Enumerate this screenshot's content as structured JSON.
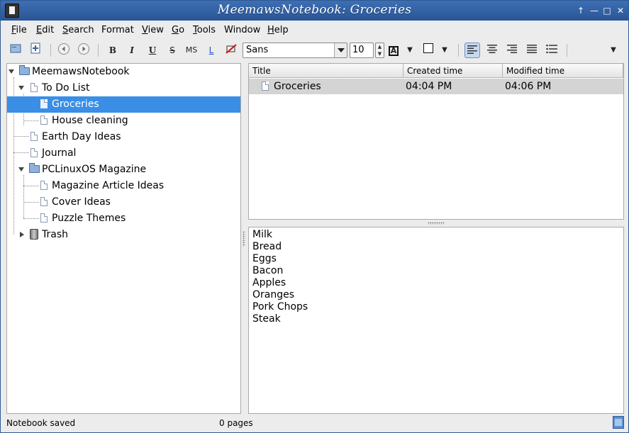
{
  "window": {
    "title": "MeemawsNotebook: Groceries"
  },
  "menubar": [
    {
      "label": "File",
      "accel": "F",
      "rest": "ile"
    },
    {
      "label": "Edit",
      "accel": "E",
      "rest": "dit"
    },
    {
      "label": "Search",
      "accel": "S",
      "rest": "earch"
    },
    {
      "label": "Format",
      "accel": "",
      "rest": "Format"
    },
    {
      "label": "View",
      "accel": "V",
      "rest": "iew"
    },
    {
      "label": "Go",
      "accel": "G",
      "rest": "o"
    },
    {
      "label": "Tools",
      "accel": "T",
      "rest": "ools"
    },
    {
      "label": "Window",
      "accel": "",
      "rest": "Window"
    },
    {
      "label": "Help",
      "accel": "H",
      "rest": "elp"
    }
  ],
  "toolbar": {
    "bold": "B",
    "italic": "I",
    "underline": "U",
    "strike": "S",
    "mono": "MS",
    "link": "L",
    "font_family": "Sans",
    "font_size": "10",
    "text_color": "A"
  },
  "tree": [
    {
      "label": "MeemawsNotebook",
      "icon": "folder-open-icon",
      "level": 0,
      "expanded": true
    },
    {
      "label": "To Do List",
      "icon": "page-icon",
      "level": 1,
      "expanded": true
    },
    {
      "label": "Groceries",
      "icon": "page-icon",
      "level": 2,
      "selected": true
    },
    {
      "label": "House cleaning",
      "icon": "page-icon",
      "level": 2
    },
    {
      "label": "Earth Day Ideas",
      "icon": "page-icon",
      "level": 1
    },
    {
      "label": "Journal",
      "icon": "page-icon",
      "level": 1
    },
    {
      "label": "PCLinuxOS Magazine",
      "icon": "folder-open-icon",
      "level": 1,
      "expanded": true
    },
    {
      "label": "Magazine Article Ideas",
      "icon": "page-icon",
      "level": 2
    },
    {
      "label": "Cover Ideas",
      "icon": "page-icon",
      "level": 2
    },
    {
      "label": "Puzzle Themes",
      "icon": "page-icon",
      "level": 2
    },
    {
      "label": "Trash",
      "icon": "trash-icon",
      "level": 1,
      "expanded": false
    }
  ],
  "list": {
    "headers": [
      "Title",
      "Created time",
      "Modified time"
    ],
    "rows": [
      {
        "title": "Groceries",
        "created": "04:04 PM",
        "modified": "04:06 PM"
      }
    ]
  },
  "editor": {
    "lines": [
      "Milk",
      "Bread",
      "Eggs",
      "Bacon",
      "Apples",
      "Oranges",
      "Pork Chops",
      "Steak"
    ]
  },
  "status": {
    "message": "Notebook saved",
    "pages": "0 pages"
  },
  "colors": {
    "titlebar": "#2a5596",
    "selection": "#3a8ee6",
    "row_highlight": "#d4d4d4"
  }
}
